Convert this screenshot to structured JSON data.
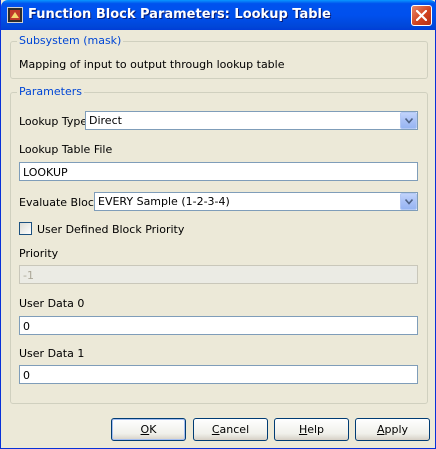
{
  "window": {
    "title": "Function Block Parameters: Lookup Table"
  },
  "subsystem": {
    "legend": "Subsystem (mask)",
    "description": "Mapping of input to output through lookup table"
  },
  "parameters": {
    "legend": "Parameters",
    "lookup_type_label": "Lookup Type",
    "lookup_type_value": "Direct",
    "lookup_file_label": "Lookup Table File",
    "lookup_file_value": "LOOKUP",
    "evaluate_label": "Evaluate Block",
    "evaluate_value": "EVERY Sample (1-2-3-4)",
    "user_priority_label": "User Defined Block Priority",
    "user_priority_checked": false,
    "priority_label": "Priority",
    "priority_value": "-1",
    "user_data0_label": "User Data 0",
    "user_data0_value": "0",
    "user_data1_label": "User Data 1",
    "user_data1_value": "0"
  },
  "buttons": {
    "ok": {
      "underline": "O",
      "rest": "K"
    },
    "cancel": {
      "underline": "C",
      "rest": "ancel"
    },
    "help": {
      "underline": "H",
      "rest": "elp"
    },
    "apply": {
      "underline": "A",
      "rest": "pply"
    }
  },
  "icons": {
    "app": "simulink-block-icon",
    "close": "close-icon",
    "dropdown": "chevron-down-icon"
  },
  "colors": {
    "titlebar": "#0053ee",
    "legend_text": "#0046d5",
    "close_button": "#d2431f"
  }
}
